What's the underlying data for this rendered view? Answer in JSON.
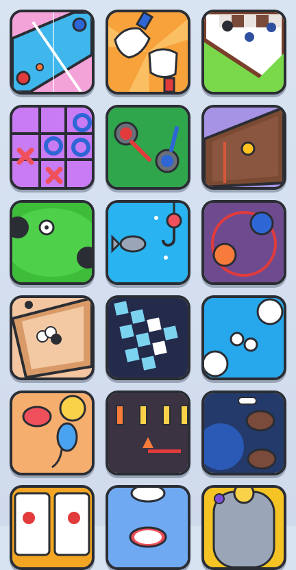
{
  "tiles": [
    {
      "id": "ping-pong",
      "icon": "ping-pong-icon",
      "bg": "#f4a3d9"
    },
    {
      "id": "rock-paper-scissors",
      "icon": "rock-paper-scissors-icon",
      "bg": "#f7a23b"
    },
    {
      "id": "chess",
      "icon": "chess-icon",
      "bg": "#79d94a"
    },
    {
      "id": "tic-tac-toe",
      "icon": "tic-tac-toe-icon",
      "bg": "#c87bf2"
    },
    {
      "id": "sword-fight",
      "icon": "sword-fight-icon",
      "bg": "#2fa64b"
    },
    {
      "id": "air-hockey",
      "icon": "air-hockey-icon",
      "bg": "#a793e6"
    },
    {
      "id": "soccer",
      "icon": "soccer-icon",
      "bg": "#3dbd3a"
    },
    {
      "id": "fishing",
      "icon": "fishing-icon",
      "bg": "#29b3f0"
    },
    {
      "id": "sumo",
      "icon": "sumo-icon",
      "bg": "#6e4b8f"
    },
    {
      "id": "carrom",
      "icon": "carrom-icon",
      "bg": "#f3c5a0"
    },
    {
      "id": "memory-cards",
      "icon": "memory-cards-icon",
      "bg": "#232a4a"
    },
    {
      "id": "snowball",
      "icon": "snowball-icon",
      "bg": "#27a8ec"
    },
    {
      "id": "mouse-cheese",
      "icon": "mouse-cheese-icon",
      "bg": "#f6ae6f"
    },
    {
      "id": "torch-wave",
      "icon": "torch-wave-icon",
      "bg": "#3b3342"
    },
    {
      "id": "dog-bone",
      "icon": "dog-bone-icon",
      "bg": "#233a6b"
    },
    {
      "id": "slot-machine",
      "icon": "slot-machine-icon",
      "bg": "#f2a623"
    },
    {
      "id": "tennis",
      "icon": "tennis-icon",
      "bg": "#6fa9f2"
    },
    {
      "id": "pinball",
      "icon": "pinball-icon",
      "bg": "#f5c323"
    }
  ]
}
